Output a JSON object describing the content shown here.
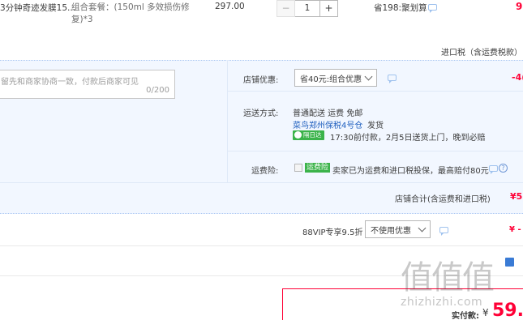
{
  "item": {
    "title": "3分钟奇迹发膜15...",
    "sku": "组合套餐：(150ml 多效损伤修复)*3",
    "unit_price": "297.00",
    "qty_minus": "−",
    "qty": "1",
    "qty_plus": "+",
    "discount_note": "省198:聚划算",
    "subtotal_partial": "9"
  },
  "import_tax_note": "进口税（含运费税款）",
  "message": {
    "placeholder": "留先和商家协商一致，付款后商家可见",
    "counter": "0/200"
  },
  "shop_discount": {
    "label": "店铺优惠:",
    "selected": "省40元:组合优惠",
    "amount": "-4("
  },
  "shipping": {
    "label": "运送方式:",
    "method": "普通配送 运费 免邮",
    "warehouse": "菜鸟郑州保税4号仓",
    "ship_text": "发货",
    "badge": "隔日达",
    "promise": "17:30前付款，2月5日送货上门，晚到必赔"
  },
  "insurance": {
    "label": "运费险:",
    "badge": "运费险",
    "text": "卖家已为运费和进口税投保，最高赔付80元"
  },
  "shop_total": {
    "label": "店铺合计(含运费和进口税)",
    "amount": "¥5"
  },
  "vip": {
    "label": "88VIP专享9.5折",
    "selected": "不使用优惠",
    "amount": "¥ -"
  },
  "pay": {
    "label": "实付款:",
    "currency": "¥",
    "amount": "59.0"
  },
  "watermark": {
    "glyphs": "值值值",
    "domain": "zhizhizhi.com"
  },
  "colors": {
    "accent_red": "#ff0036",
    "panel_blue": "#f2f7ff",
    "badge_green": "#3bb34a"
  }
}
